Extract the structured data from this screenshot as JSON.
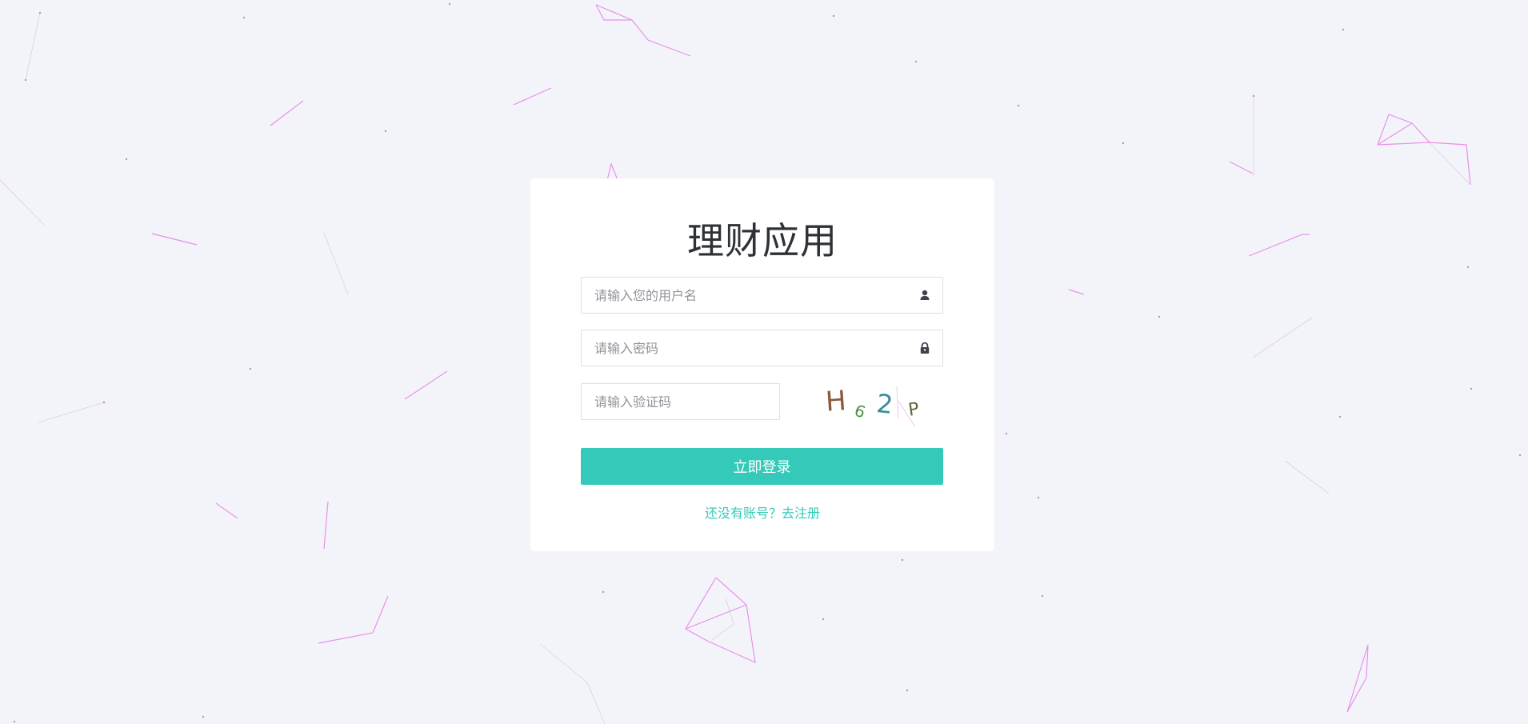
{
  "app": {
    "title": "理财应用"
  },
  "form": {
    "username_placeholder": "请输入您的用户名",
    "username_value": "",
    "password_placeholder": "请输入密码",
    "password_value": "",
    "captcha_placeholder": "请输入验证码",
    "captcha_value": "",
    "captcha_chars": [
      "H",
      "6",
      "2",
      "P"
    ],
    "login_label": "立即登录",
    "register_label": "还没有账号？去注册"
  },
  "icons": {
    "username": "user-icon",
    "password": "lock-icon"
  },
  "colors": {
    "accent": "#34c9b9",
    "background": "#f3f4f9",
    "card": "#ffffff",
    "title": "#2e3136",
    "particles": "#e87ee8"
  }
}
